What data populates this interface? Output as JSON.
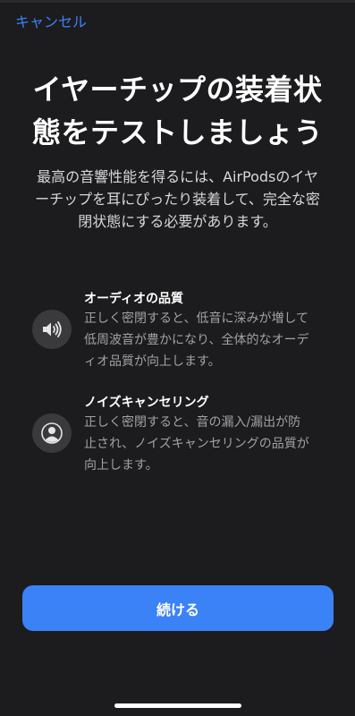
{
  "nav": {
    "cancel_label": "キャンセル"
  },
  "header": {
    "title_line1": "イヤーチップの装着状",
    "title_line2": "態をテストしましょう"
  },
  "description": {
    "line1": "最高の音響性能を得るには、AirPodsのイヤ",
    "line2": "ーチップを耳にぴったり装着して、完全な密",
    "line3": "閉状態にする必要があります。"
  },
  "features": [
    {
      "icon": "speaker-icon",
      "title": "オーディオの品質",
      "body_line1": "正しく密閉すると、低音に深みが増して",
      "body_line2": "低周波音が豊かになり、全体的なオーデ",
      "body_line3": "ィオ品質が向上します。"
    },
    {
      "icon": "person-noise-cancel-icon",
      "title": "ノイズキャンセリング",
      "body_line1": "正しく密閉すると、音の漏入/漏出が防",
      "body_line2": "止され、ノイズキャンセリングの品質が",
      "body_line3": "向上します。"
    }
  ],
  "actions": {
    "continue_label": "続ける"
  },
  "colors": {
    "accent": "#3b82f6",
    "background": "#1c1c1e",
    "icon_circle": "#3a3a3c",
    "secondary_text": "#a1a1a6"
  }
}
